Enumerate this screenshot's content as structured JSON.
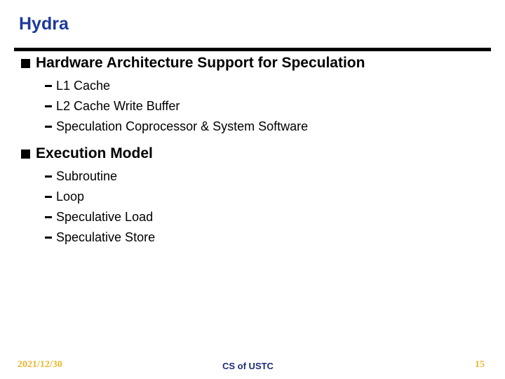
{
  "slide": {
    "title": "Hydra",
    "sections": [
      {
        "heading": "Hardware Architecture Support for Speculation",
        "items": [
          "L1 Cache",
          "L2 Cache Write Buffer",
          "Speculation Coprocessor & System Software"
        ]
      },
      {
        "heading": "Execution Model",
        "items": [
          "Subroutine",
          "Loop",
          "Speculative Load",
          "Speculative Store"
        ]
      }
    ],
    "bullet_icon": "square-bullet",
    "sub_bullet_icon": "dash",
    "title_color": "#1c3a9c"
  },
  "footer": {
    "date": "2021/12/30",
    "center": "CS of USTC",
    "page": "15"
  }
}
